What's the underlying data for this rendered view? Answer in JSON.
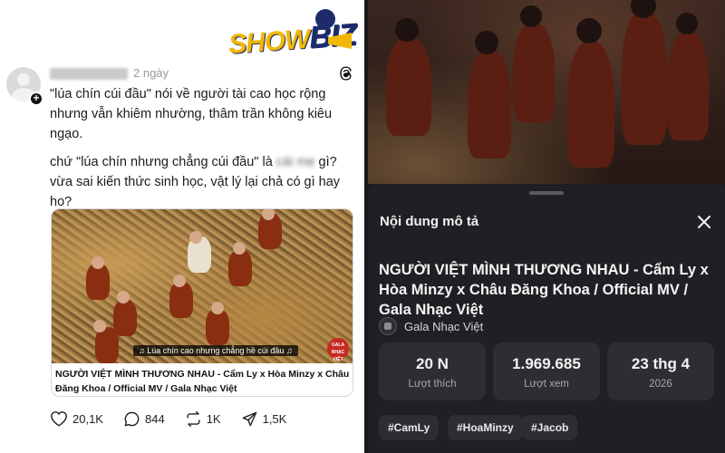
{
  "logo": {
    "part1": "SHOW",
    "part2": "BIZ"
  },
  "post": {
    "username": "nuocvanchay",
    "time": "2 ngày",
    "paragraph1": "\"lúa chín cúi đầu\" nói về người tài cao học rộng nhưng vẫn khiêm nhường, thâm trần không kiêu ngạo.",
    "paragraph2_before": "chứ \"lúa chín nhưng chẳng cúi đầu\" là ",
    "paragraph2_blur": "cái mẹ",
    "paragraph2_after": " gì? vừa sai kiến thức sinh học, vật lý lại chả có gì hay ho?",
    "video": {
      "caption": "♫ Lúa chín cao nhưng chẳng hề cúi đầu ♫",
      "badge": "GALA NHẠC VIỆT",
      "title": "NGƯỜI VIỆT MÌNH THƯƠNG NHAU - Cẩm Ly x Hòa Minzy x Châu Đăng Khoa / Official MV / Gala Nhạc Việt"
    },
    "actions": {
      "likes": "20,1K",
      "comments": "844",
      "reposts": "1K",
      "shares": "1,5K"
    }
  },
  "description": {
    "sheet_title": "Nội dung mô tả",
    "video_title": "NGƯỜI VIỆT MÌNH THƯƠNG NHAU - Cẩm Ly x Hòa Minzy x Châu Đăng Khoa / Official MV / Gala Nhạc Việt",
    "channel": "Gala Nhạc Việt",
    "stats": [
      {
        "value": "20 N",
        "label": "Lượt thích"
      },
      {
        "value": "1.969.685",
        "label": "Lượt xem"
      },
      {
        "value": "23 thg 4",
        "label": "2026"
      }
    ],
    "tags": [
      "#CamLy",
      "#HoaMinzy",
      "#Jacob"
    ]
  },
  "colors": {
    "dark_bg": "#1f2024",
    "card_bg": "#2c2e33",
    "logo_yellow": "#f2b705",
    "logo_navy": "#1e2b6b"
  },
  "icons": [
    "threads-icon",
    "heart-icon",
    "comment-icon",
    "repost-icon",
    "share-icon",
    "close-icon"
  ]
}
